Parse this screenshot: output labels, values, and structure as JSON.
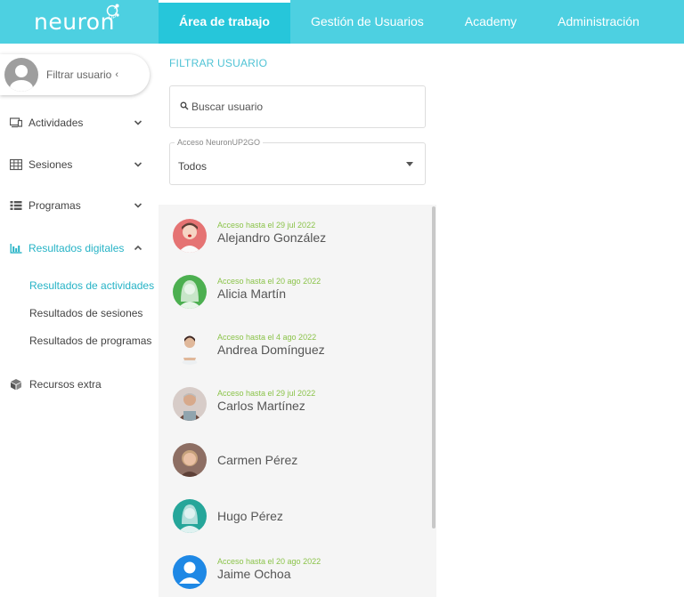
{
  "brand": {
    "name": "neuron",
    "badge": "UP"
  },
  "topnav": {
    "items": [
      {
        "label": "Área de trabajo"
      },
      {
        "label": "Gestión de Usuarios"
      },
      {
        "label": "Academy"
      },
      {
        "label": "Administración"
      }
    ],
    "active_index": 0
  },
  "sidebar": {
    "user_filter_label": "Filtrar usuario",
    "user_filter_chevron": "‹",
    "items": [
      {
        "label": "Actividades",
        "icon": "monitor-icon",
        "expanded": false
      },
      {
        "label": "Sesiones",
        "icon": "grid-icon",
        "expanded": false
      },
      {
        "label": "Programas",
        "icon": "list-icon",
        "expanded": false
      },
      {
        "label": "Resultados digitales",
        "icon": "bar-chart-icon",
        "expanded": true
      },
      {
        "label": "Recursos extra",
        "icon": "cube-icon"
      }
    ],
    "subitems": [
      {
        "label": "Resultados de actividades",
        "active": true
      },
      {
        "label": "Resultados de sesiones",
        "active": false
      },
      {
        "label": "Resultados de programas",
        "active": false
      }
    ]
  },
  "filter_panel": {
    "title": "FILTRAR USUARIO",
    "search": {
      "placeholder": "Buscar usuario",
      "value": ""
    },
    "access_select": {
      "label": "Acceso NeuronUP2GO",
      "value": "Todos"
    }
  },
  "users": [
    {
      "access": "Acceso hasta el 29 jul 2022",
      "name": "Alejandro González"
    },
    {
      "access": "Acceso hasta el 20 ago 2022",
      "name": "Alicia Martín"
    },
    {
      "access": "Acceso hasta el 4 ago 2022",
      "name": "Andrea Domínguez"
    },
    {
      "access": "Acceso hasta el 29 jul 2022",
      "name": "Carlos Martínez"
    },
    {
      "access": "",
      "name": "Carmen Pérez"
    },
    {
      "access": "",
      "name": "Hugo Pérez"
    },
    {
      "access": "Acceso hasta el 20 ago 2022",
      "name": "Jaime Ochoa"
    }
  ],
  "colors": {
    "topbar": "#4dd0e1",
    "topbar_active": "#26c6da",
    "accent": "#26b3c6",
    "access_green": "#8bc34a"
  }
}
